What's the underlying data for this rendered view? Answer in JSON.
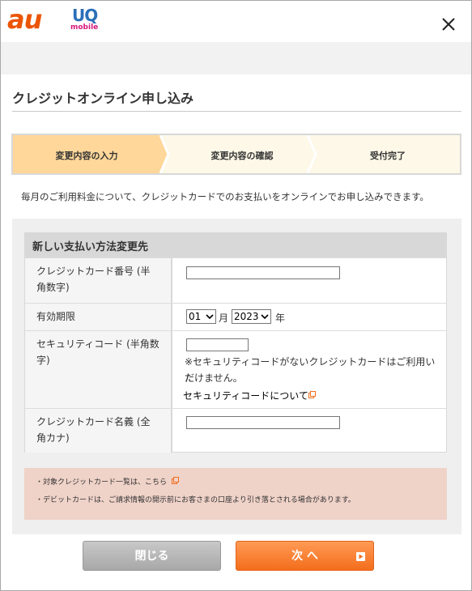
{
  "header": {
    "brand_au": "au",
    "brand_uq": "UQ",
    "brand_uq_sub": "mobile",
    "close_icon": "close-icon"
  },
  "page": {
    "title": "クレジットオンライン申し込み",
    "intro": "毎月のご利用料金について、クレジットカードでのお支払いをオンラインでお申し込みできます。"
  },
  "steps": [
    {
      "label": "変更内容の入力",
      "active": true
    },
    {
      "label": "変更内容の確認",
      "active": false
    },
    {
      "label": "受付完了",
      "active": false
    }
  ],
  "form": {
    "section_title": "新しい支払い方法変更先",
    "card_number": {
      "label": "クレジットカード番号 (半角数字)",
      "value": ""
    },
    "expiry": {
      "label": "有効期限",
      "month": "01",
      "month_unit": "月",
      "year": "2023",
      "year_unit": "年"
    },
    "security_code": {
      "label": "セキュリティコード (半角数字)",
      "value": "",
      "note_line1": "※セキュリティコードがないクレジットカードはご利用いた",
      "note_line2": "だけません。",
      "link": "セキュリティコードについて"
    },
    "card_name": {
      "label": "クレジットカード名義 (全角カナ)",
      "value": ""
    }
  },
  "notice": {
    "line1": "・対象クレジットカード一覧は、こちら",
    "line2": "・デビットカードは、ご請求情報の開示前にお客さまの口座より引き落とされる場合があります。"
  },
  "buttons": {
    "close": "閉じる",
    "next": "次 へ"
  },
  "colors": {
    "au_brand": "#eb5505",
    "active_step": "#ffd79a",
    "next_button": "#f36e1c",
    "notice_bg": "#efd2c8"
  }
}
